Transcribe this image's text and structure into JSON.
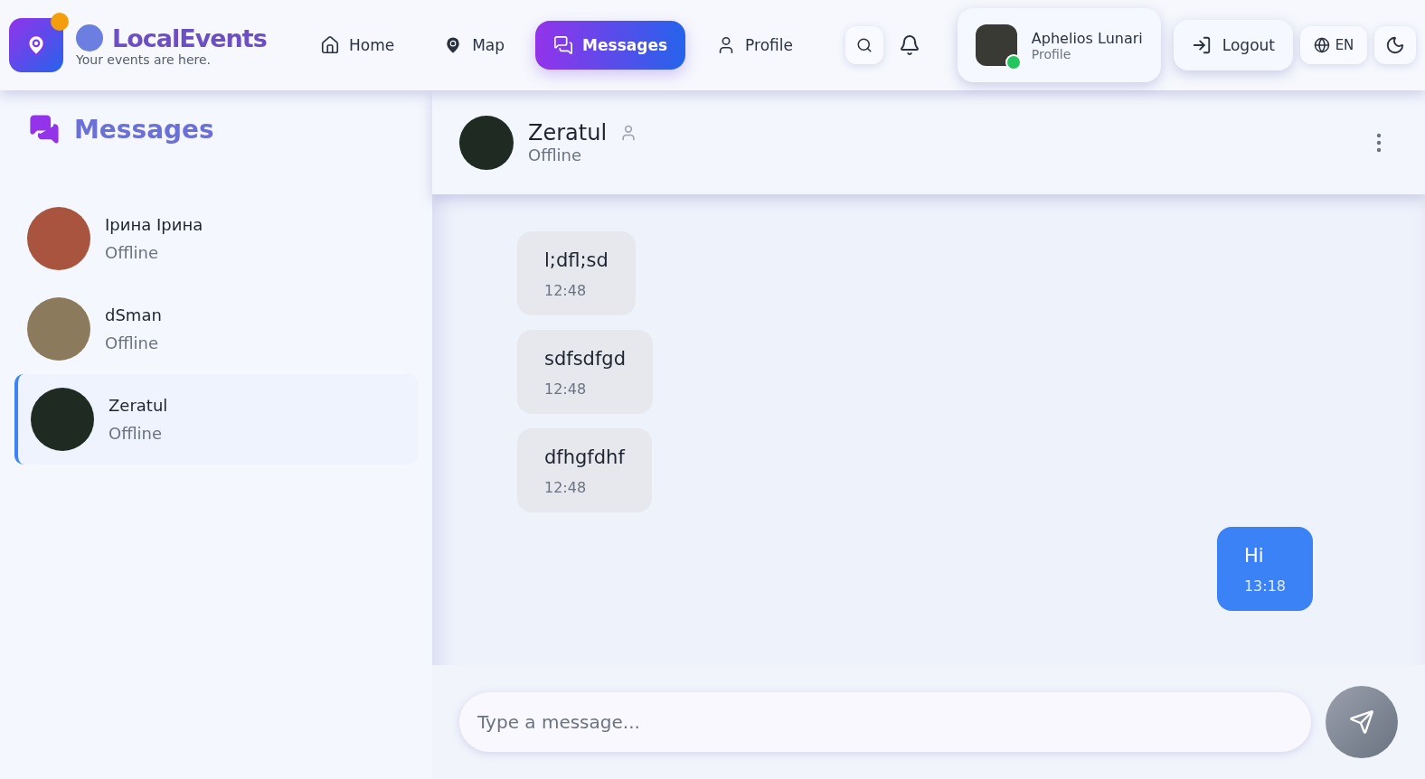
{
  "brand": {
    "name": "LocalEvents",
    "tagline": "Your events are here."
  },
  "nav": [
    {
      "label": "Home",
      "kind": "home",
      "selected": false
    },
    {
      "label": "Map",
      "kind": "pin",
      "selected": false
    },
    {
      "label": "Messages",
      "kind": "chat",
      "selected": true
    },
    {
      "label": "Profile",
      "kind": "user",
      "selected": false
    }
  ],
  "user": {
    "name": "Aphelios Lunari",
    "subtitle": "Profile",
    "online": true
  },
  "logout": "Logout",
  "language": "EN",
  "sidebar": {
    "title": "Messages",
    "conversations": [
      {
        "name": "Ірина Ірина",
        "status": "Offline",
        "selected": false
      },
      {
        "name": "dSman",
        "status": "Offline",
        "selected": false
      },
      {
        "name": "Zeratul",
        "status": "Offline",
        "selected": true
      }
    ]
  },
  "chat": {
    "name": "Zeratul",
    "status": "Offline",
    "messages": [
      {
        "kind": "received",
        "text": "l;dfl;sd",
        "time": "12:48"
      },
      {
        "kind": "received",
        "text": "sdfsdfgd",
        "time": "12:48"
      },
      {
        "kind": "received",
        "text": "dfhgfdhf",
        "time": "12:48"
      },
      {
        "kind": "sent",
        "text": "Hi",
        "time": "13:18"
      }
    ],
    "input": {
      "placeholder": "Type a message..."
    }
  }
}
